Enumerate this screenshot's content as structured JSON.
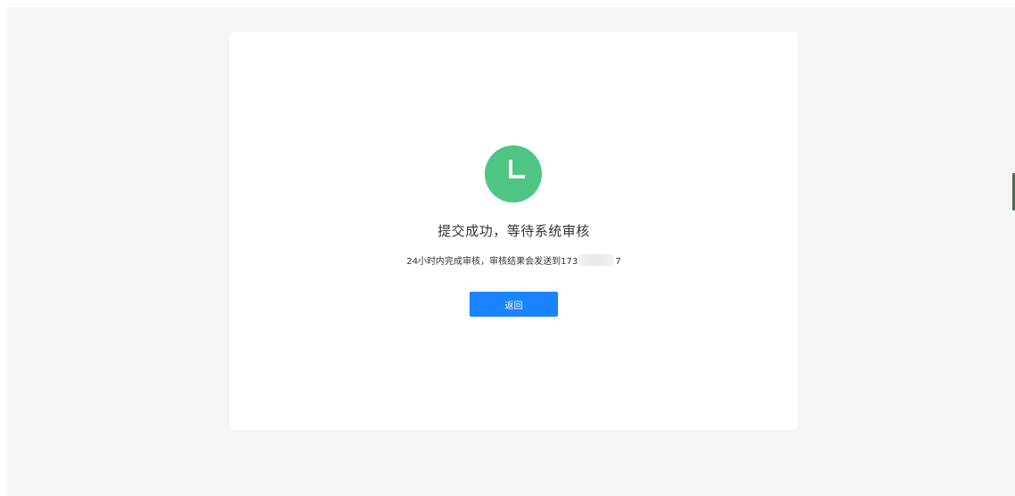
{
  "colors": {
    "background": "#f5f5f5",
    "card": "#ffffff",
    "success_icon": "#4fc584",
    "primary_button": "#1a83ff"
  },
  "status": {
    "icon": "clock-icon",
    "title": "提交成功，等待系统审核",
    "message_prefix": "24小时内完成审核，审核结果会发送到173",
    "message_suffix": "7"
  },
  "actions": {
    "back_label": "返回"
  }
}
